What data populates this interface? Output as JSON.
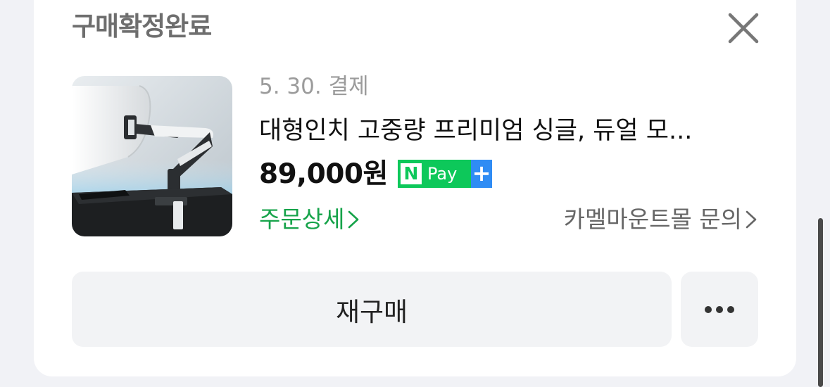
{
  "order": {
    "status": "구매확정완료",
    "date": "5. 30. 결제",
    "product_name": "대형인치 고중량 프리미엄 싱글, 듀얼 모...",
    "price": "89,000원",
    "npay": {
      "n": "N",
      "pay": "Pay",
      "plus": "+"
    },
    "order_detail_link": "주문상세",
    "seller_inquiry_link": "카멜마운트몰 문의"
  },
  "actions": {
    "rebuy_label": "재구매",
    "more_icon": "more-dots-icon"
  },
  "icons": {
    "close": "close-icon",
    "chevron": "chevron-right-icon"
  },
  "colors": {
    "npay_green": "#0dc85a",
    "npay_blue": "#2f8cf4",
    "link_green": "#16a34a"
  }
}
